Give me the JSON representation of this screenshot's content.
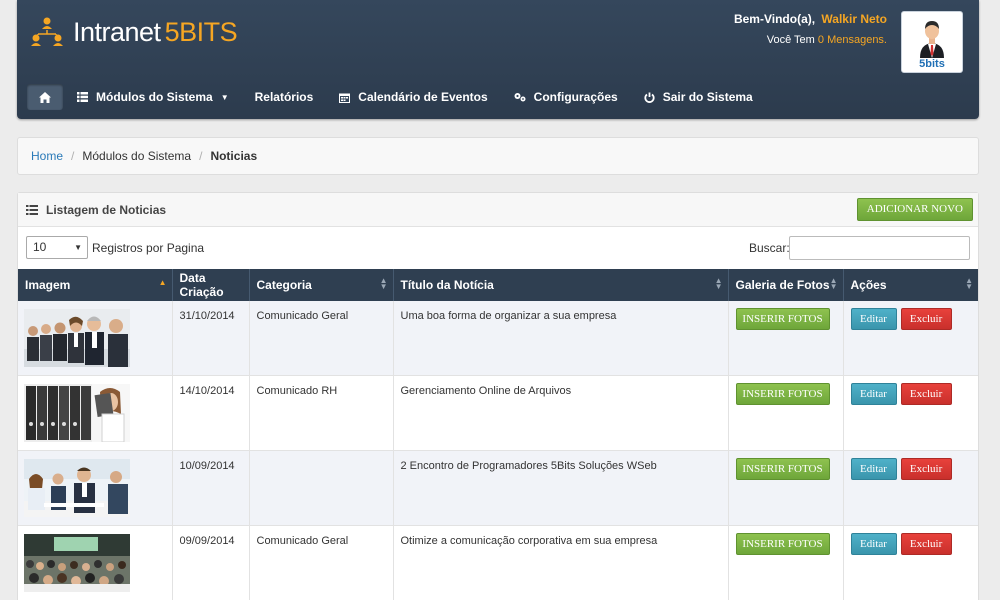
{
  "header": {
    "logo_text": "Intranet",
    "logo_brand": "5BITS",
    "welcome_prefix": "Bem-Vindo(a),",
    "user_name": "Walkir Neto",
    "messages_prefix": "Você Tem",
    "messages_count": "0 Mensagens.",
    "avatar_brand": "5bits"
  },
  "nav": {
    "items": [
      {
        "label": "Módulos do Sistema",
        "icon": "grid-list-icon"
      },
      {
        "label": "Relatórios"
      },
      {
        "label": "Calendário de Eventos",
        "icon": "calendar-icon"
      },
      {
        "label": "Configurações",
        "icon": "gears-icon"
      },
      {
        "label": "Sair do Sistema",
        "icon": "power-icon"
      }
    ]
  },
  "breadcrumb": {
    "home": "Home",
    "modules": "Módulos do Sistema",
    "current": "Noticias"
  },
  "panel": {
    "title": "Listagem de Noticias",
    "add_button": "ADICIONAR NOVO",
    "length_value": "10",
    "length_label": "Registros por Pagina",
    "search_label": "Buscar:",
    "search_value": ""
  },
  "table": {
    "columns": [
      "Imagem",
      "Data Criação",
      "Categoria",
      "Título da Notícia",
      "Galeria de Fotos",
      "Ações"
    ],
    "fotos_button": "INSERIR FOTOS",
    "edit_button": "Editar",
    "delete_button": "Excluir",
    "rows": [
      {
        "date": "31/10/2014",
        "category": "Comunicado Geral",
        "title": "Uma boa forma de organizar a sua empresa"
      },
      {
        "date": "14/10/2014",
        "category": "Comunicado RH",
        "title": "Gerenciamento Online de Arquivos"
      },
      {
        "date": "10/09/2014",
        "category": "",
        "title": "2 Encontro de Programadores 5Bits Soluções WSeb"
      },
      {
        "date": "09/09/2014",
        "category": "Comunicado Geral",
        "title": "Otimize a comunicação corporativa em sua empresa"
      }
    ]
  },
  "colors": {
    "header_bg": "#2f3f51",
    "accent_orange": "#f5a623",
    "button_green": "#7cb342",
    "button_teal": "#46a2b9",
    "button_red": "#d9342e",
    "link_blue": "#2a7ab8"
  }
}
